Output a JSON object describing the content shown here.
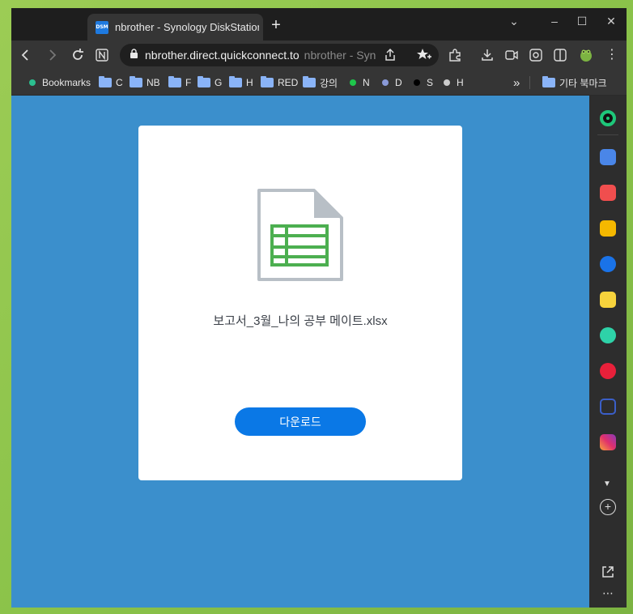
{
  "browser": {
    "tab_favicon_text": "DSM",
    "tab_title": "nbrother - Synology DiskStation",
    "new_tab": "+",
    "url": "nbrother.direct.quickconnect.to",
    "page_title_hint": "nbrother - Synology DiskStation"
  },
  "bookmarks": [
    {
      "label": "Bookmarks",
      "kind": "dot",
      "color": "#2bbf8f"
    },
    {
      "label": "C",
      "kind": "folder"
    },
    {
      "label": "NB",
      "kind": "folder"
    },
    {
      "label": "F",
      "kind": "folder"
    },
    {
      "label": "G",
      "kind": "folder"
    },
    {
      "label": "H",
      "kind": "folder"
    },
    {
      "label": "RED",
      "kind": "folder"
    },
    {
      "label": "강의",
      "kind": "folder"
    },
    {
      "label": "N",
      "kind": "dot",
      "color": "#1ec74b"
    },
    {
      "label": "D",
      "kind": "dot",
      "color": "#8a9ad8"
    },
    {
      "label": "S",
      "kind": "dot",
      "color": "#000000"
    },
    {
      "label": "H",
      "kind": "dot",
      "color": "#cccccc"
    }
  ],
  "bookmarks_overflow": "»",
  "other_bookmarks": "기타 북마크",
  "content": {
    "file_name": "보고서_3월_나의 공부 메이트.xlsx",
    "download_label": "다운로드"
  },
  "colors": {
    "page_bg": "#3b8fcc",
    "button": "#0a78e6",
    "spreadsheet_green": "#4caf50"
  }
}
